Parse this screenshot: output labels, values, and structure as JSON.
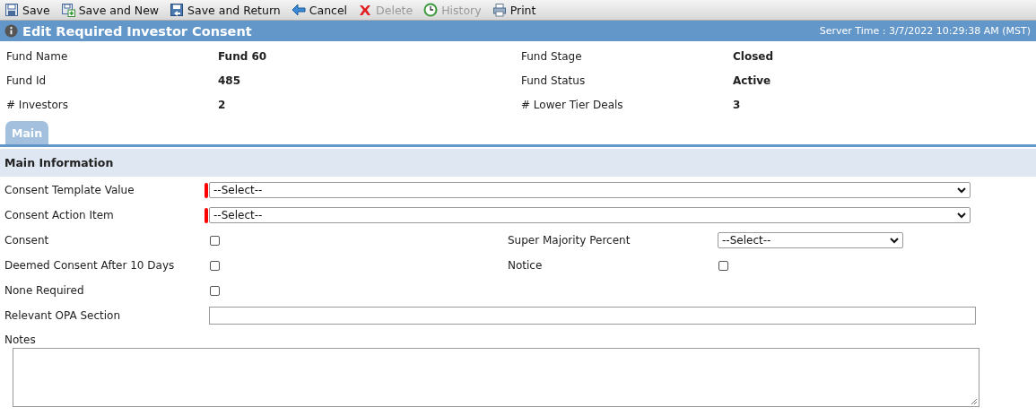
{
  "toolbar": [
    {
      "label": "Save",
      "kind": "save",
      "disabled": false
    },
    {
      "label": "Save and New",
      "kind": "save-new",
      "disabled": false
    },
    {
      "label": "Save and Return",
      "kind": "save-return",
      "disabled": false
    },
    {
      "label": "Cancel",
      "kind": "cancel",
      "disabled": false
    },
    {
      "label": "Delete",
      "kind": "delete",
      "disabled": true
    },
    {
      "label": "History",
      "kind": "history",
      "disabled": true
    },
    {
      "label": "Print",
      "kind": "print",
      "disabled": false
    }
  ],
  "title": "Edit Required Investor Consent",
  "server_time": "Server Time : 3/7/2022 10:29:38 AM (MST)",
  "summary": [
    {
      "label": "Fund Name",
      "value": "Fund 60"
    },
    {
      "label": "Fund Stage",
      "value": "Closed"
    },
    {
      "label": "Fund Id",
      "value": "485"
    },
    {
      "label": "Fund Status",
      "value": "Active"
    },
    {
      "label": "# Investors",
      "value": "2"
    },
    {
      "label": "# Lower Tier Deals",
      "value": "3"
    }
  ],
  "tabs": [
    {
      "label": "Main",
      "selected": true
    }
  ],
  "section": "Main Information",
  "rows": [
    [
      {
        "label": "Consent Template Value",
        "kind": "select",
        "required": true,
        "value": "--Select--",
        "wide": true
      }
    ],
    [
      {
        "label": "Consent Action Item",
        "kind": "select",
        "required": true,
        "value": "--Select--",
        "wide": true
      }
    ],
    [
      {
        "label": "Consent",
        "kind": "checkbox",
        "required": false,
        "checked": false
      },
      {
        "label": "Super Majority Percent",
        "kind": "select",
        "required": false,
        "value": "--Select--",
        "wide": false
      }
    ],
    [
      {
        "label": "Deemed Consent After 10 Days",
        "kind": "checkbox",
        "required": false,
        "checked": false
      },
      {
        "label": "Notice",
        "kind": "checkbox",
        "required": false,
        "checked": false
      }
    ],
    [
      {
        "label": "None Required",
        "kind": "checkbox",
        "required": false,
        "checked": false
      }
    ],
    [
      {
        "label": "Relevant OPA Section",
        "kind": "text",
        "required": false
      }
    ]
  ],
  "notes": {
    "label": "Notes"
  }
}
